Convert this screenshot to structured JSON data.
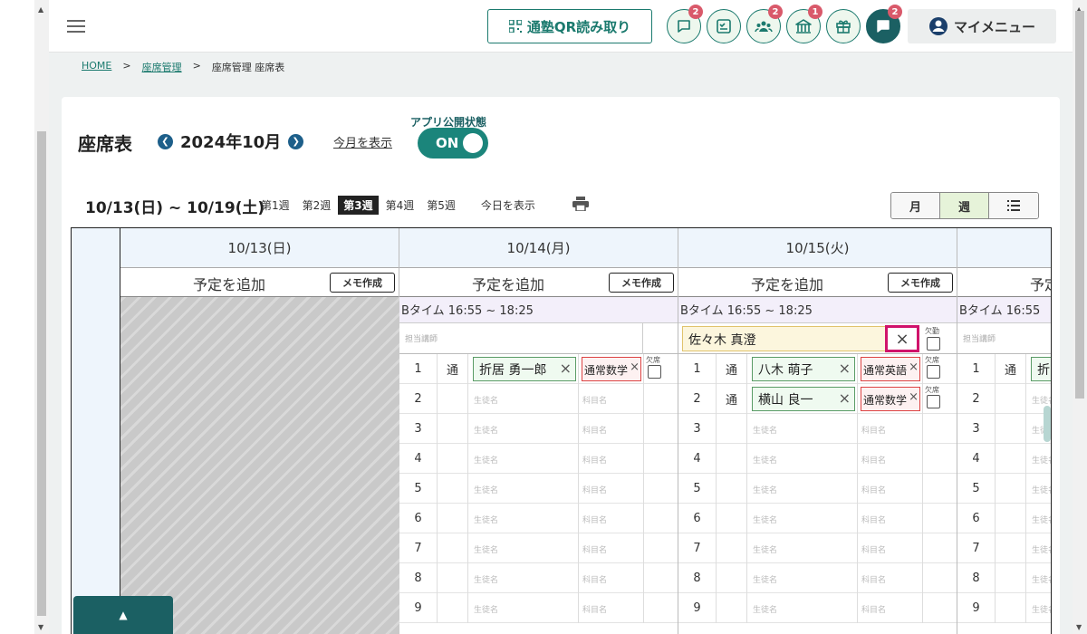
{
  "header": {
    "qr_button": "通塾QR読み取り",
    "icons": [
      {
        "name": "chat-bubble-icon",
        "badge": "2"
      },
      {
        "name": "checklist-icon",
        "badge": ""
      },
      {
        "name": "group-icon",
        "badge": "2"
      },
      {
        "name": "school-building-icon",
        "badge": "1"
      },
      {
        "name": "gift-icon",
        "badge": ""
      },
      {
        "name": "message-filled-icon",
        "badge": "2"
      }
    ],
    "my_menu": "マイメニュー"
  },
  "breadcrumb": {
    "home": "HOME",
    "sep": ">",
    "seat_mgmt": "座席管理",
    "current": "座席管理 座席表"
  },
  "page": {
    "title": "座席表",
    "month": "2024年10月",
    "show_this_month": "今月を表示",
    "app_status_label": "アプリ公開状態",
    "toggle": "ON"
  },
  "week": {
    "range": "10/13(日) ~ 10/19(土)",
    "tabs": [
      "第1週",
      "第2週",
      "第3週",
      "第4週",
      "第5週"
    ],
    "active_tab": "第3週",
    "show_today": "今日を表示"
  },
  "view_switch": {
    "month": "月",
    "week": "週",
    "list_icon": "list-icon",
    "active": "週"
  },
  "labels": {
    "add_schedule": "予定を追加",
    "memo": "メモ作成",
    "teacher_placeholder": "担当講師",
    "student_placeholder": "生徒名",
    "subject_placeholder": "科目名",
    "absent": "欠席",
    "absent_teacher": "欠勤",
    "close": "×"
  },
  "days": [
    {
      "date": "10/13(日)",
      "closed": true
    },
    {
      "date": "10/14(月)",
      "slot": "Bタイム 16:55 ~ 18:25",
      "teacher": "",
      "rows": [
        {
          "no": "1",
          "tag": "通",
          "student": "折居 勇一郎",
          "subject": "通常数学"
        },
        {
          "no": "2",
          "tag": "",
          "student": "",
          "subject": ""
        },
        {
          "no": "3",
          "tag": "",
          "student": "",
          "subject": ""
        },
        {
          "no": "4",
          "tag": "",
          "student": "",
          "subject": ""
        },
        {
          "no": "5",
          "tag": "",
          "student": "",
          "subject": ""
        },
        {
          "no": "6",
          "tag": "",
          "student": "",
          "subject": ""
        },
        {
          "no": "7",
          "tag": "",
          "student": "",
          "subject": ""
        },
        {
          "no": "8",
          "tag": "",
          "student": "",
          "subject": ""
        },
        {
          "no": "9",
          "tag": "",
          "student": "",
          "subject": ""
        }
      ]
    },
    {
      "date": "10/15(火)",
      "slot": "Bタイム 16:55 ~ 18:25",
      "teacher": "佐々木 真澄",
      "rows": [
        {
          "no": "1",
          "tag": "通",
          "student": "八木 萌子",
          "subject": "通常英語"
        },
        {
          "no": "2",
          "tag": "通",
          "student": "横山 良一",
          "subject": "通常数学"
        },
        {
          "no": "3",
          "tag": "",
          "student": "",
          "subject": ""
        },
        {
          "no": "4",
          "tag": "",
          "student": "",
          "subject": ""
        },
        {
          "no": "5",
          "tag": "",
          "student": "",
          "subject": ""
        },
        {
          "no": "6",
          "tag": "",
          "student": "",
          "subject": ""
        },
        {
          "no": "7",
          "tag": "",
          "student": "",
          "subject": ""
        },
        {
          "no": "8",
          "tag": "",
          "student": "",
          "subject": ""
        },
        {
          "no": "9",
          "tag": "",
          "student": "",
          "subject": ""
        }
      ]
    },
    {
      "date": "",
      "slot": "Bタイム 16:55",
      "teacher": "",
      "rows": [
        {
          "no": "1",
          "tag": "通",
          "student": "折",
          "subject": ""
        },
        {
          "no": "2",
          "tag": "",
          "student": "",
          "subject": ""
        },
        {
          "no": "3",
          "tag": "",
          "student": "",
          "subject": ""
        },
        {
          "no": "4",
          "tag": "",
          "student": "",
          "subject": ""
        },
        {
          "no": "5",
          "tag": "",
          "student": "",
          "subject": ""
        },
        {
          "no": "6",
          "tag": "",
          "student": "",
          "subject": ""
        },
        {
          "no": "7",
          "tag": "",
          "student": "",
          "subject": ""
        },
        {
          "no": "8",
          "tag": "",
          "student": "",
          "subject": ""
        },
        {
          "no": "9",
          "tag": "",
          "student": "",
          "subject": ""
        }
      ]
    }
  ],
  "colors": {
    "brand": "#1b7a6e",
    "brand_dark": "#1b6063",
    "badge": "#d9596a",
    "highlight": "#d0136b"
  }
}
